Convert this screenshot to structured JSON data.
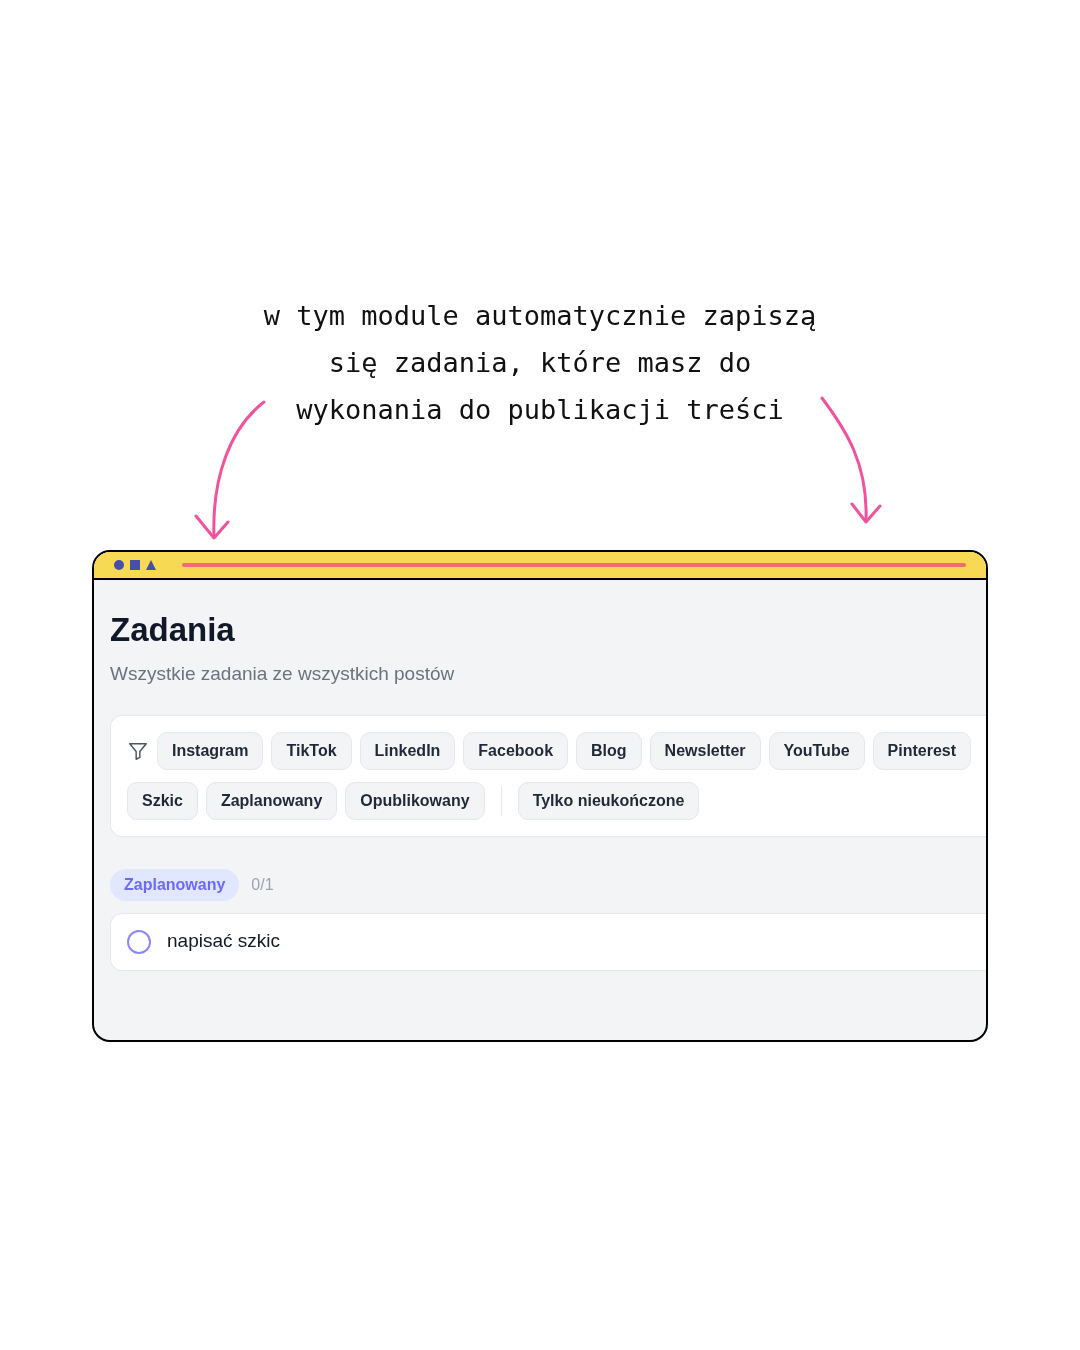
{
  "caption": {
    "lines": [
      "w tym module automatycznie zapiszą",
      "się zadania, które masz do",
      "wykonania do publikacji treści"
    ]
  },
  "page": {
    "title": "Zadania",
    "subtitle": "Wszystkie zadania ze wszystkich postów"
  },
  "platform_filters": [
    {
      "label": "Instagram",
      "selected": false
    },
    {
      "label": "TikTok",
      "selected": false
    },
    {
      "label": "LinkedIn",
      "selected": false
    },
    {
      "label": "Facebook",
      "selected": false
    },
    {
      "label": "Blog",
      "selected": false
    },
    {
      "label": "Newsletter",
      "selected": false
    },
    {
      "label": "YouTube",
      "selected": false
    },
    {
      "label": "Pinterest",
      "selected": false
    }
  ],
  "status_filters": [
    {
      "label": "Szkic",
      "selected": false
    },
    {
      "label": "Zaplanowany",
      "selected": false
    },
    {
      "label": "Opublikowany",
      "selected": false
    }
  ],
  "extra_filters": [
    {
      "label": "Tylko nieukończone",
      "selected": false
    }
  ],
  "groups": [
    {
      "status": "Zaplanowany",
      "count": "0/1",
      "tasks": [
        {
          "text": "napisać szkic",
          "checked": false
        }
      ]
    }
  ]
}
